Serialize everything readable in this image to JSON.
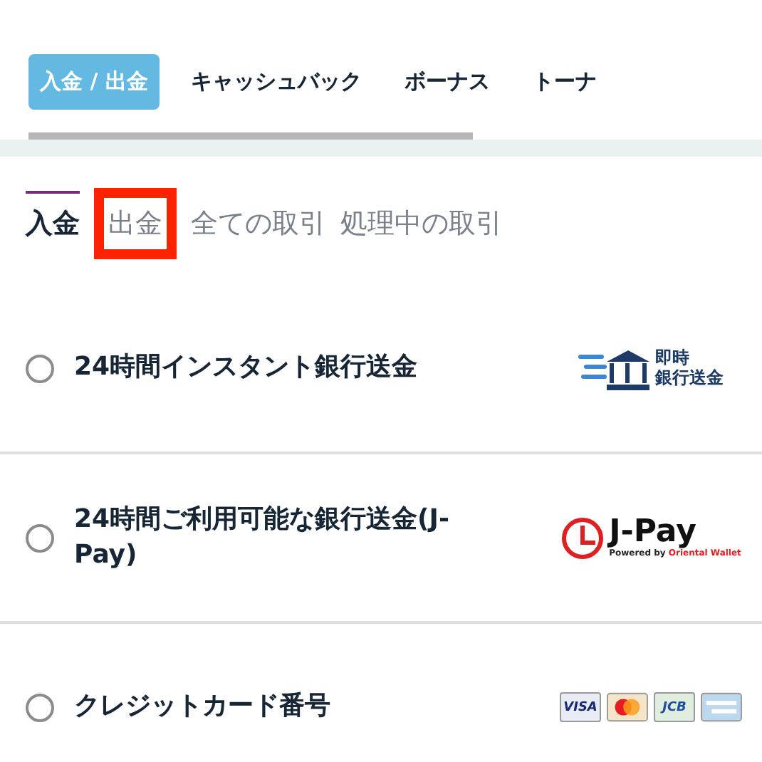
{
  "top_tabs": [
    {
      "label": "入金 / 出金",
      "selected": true
    },
    {
      "label": "キャッシュバック",
      "selected": false
    },
    {
      "label": "ボーナス",
      "selected": false
    },
    {
      "label": "トーナ",
      "selected": false
    }
  ],
  "sub_tabs": [
    {
      "label": "入金",
      "selected": true,
      "highlighted": false
    },
    {
      "label": "出金",
      "selected": false,
      "highlighted": true
    },
    {
      "label": "全ての取引",
      "selected": false,
      "highlighted": false
    },
    {
      "label": "処理中の取引",
      "selected": false,
      "highlighted": false
    }
  ],
  "methods": [
    {
      "label": "24時間インスタント銀行送金",
      "selected": false,
      "logo": {
        "kind": "bank",
        "lines": [
          "即時",
          "銀行送金"
        ]
      }
    },
    {
      "label": "24時間ご利用可能な銀行送金(J-Pay)",
      "selected": false,
      "logo": {
        "kind": "jpay",
        "name": "J-Pay",
        "tagline": "Powered by",
        "brand": "Oriental Wallet"
      }
    },
    {
      "label": "クレジットカード番号",
      "selected": false,
      "logo": {
        "kind": "cards",
        "visa": "VISA",
        "jcb": "JCB"
      }
    }
  ]
}
